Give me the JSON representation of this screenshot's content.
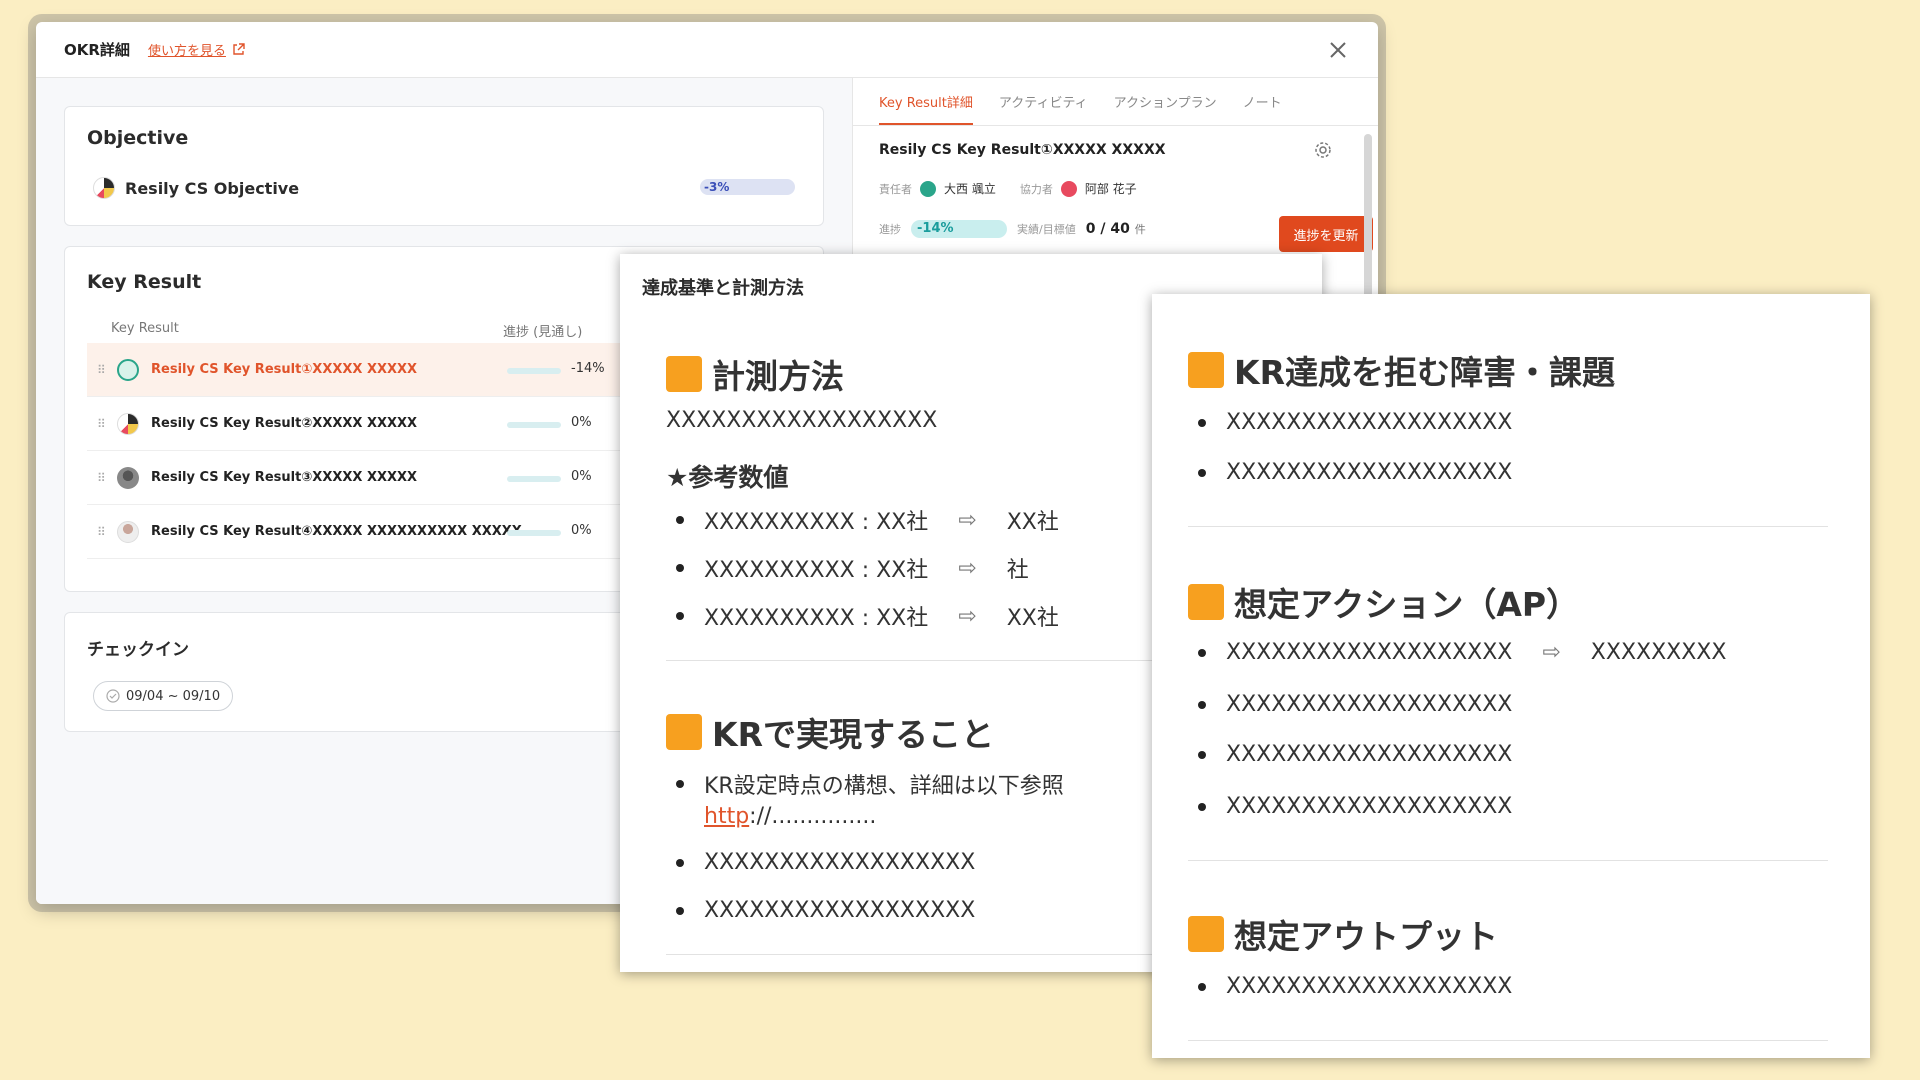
{
  "modal": {
    "title": "OKR詳細",
    "howto_link": "使い方を見る"
  },
  "objective": {
    "heading": "Objective",
    "name": "Resily CS Objective",
    "progress": "-3%"
  },
  "key_result": {
    "heading": "Key Result",
    "col_name": "Key Result",
    "col_progress": "進捗 (見通し)",
    "rows": [
      {
        "label": "Resily CS Key Result①XXXXX XXXXX",
        "progress": "-14%"
      },
      {
        "label": "Resily CS Key Result②XXXXX XXXXX",
        "progress": "0%"
      },
      {
        "label": "Resily CS Key Result③XXXXX XXXXX",
        "progress": "0%"
      },
      {
        "label": "Resily CS Key Result④XXXXX XXXXXXXXXX XXXXX",
        "progress": "0%"
      }
    ]
  },
  "checkin": {
    "heading": "チェックイン",
    "date": "09/04 ~ 09/10"
  },
  "detail": {
    "tabs": [
      "Key Result詳細",
      "アクティビティ",
      "アクションプラン",
      "ノート"
    ],
    "kr_title": "Resily CS Key Result①XXXXX XXXXX",
    "owner_label": "責任者",
    "owner_name": "大西 颯立",
    "collab_label": "協力者",
    "collab_name": "阿部 花子",
    "progress_label": "進捗",
    "progress_value": "-14%",
    "actual_label": "実績/目標値",
    "actual_value": "0 / 40",
    "actual_unit": "件",
    "update_button": "進捗を更新"
  },
  "panel_a": {
    "heading": "達成基準と計測方法",
    "sec1_title": "計測方法",
    "sec1_text": "XXXXXXXXXXXXXXXXXX",
    "ref_title": "★参考数値",
    "ref_items": [
      {
        "left": "XXXXXXXXXX : XX社",
        "arrow": "⇨",
        "right": "XX社"
      },
      {
        "left": "XXXXXXXXXX : XX社",
        "arrow": "⇨",
        "right": "社"
      },
      {
        "left": "XXXXXXXXXX : XX社",
        "arrow": "⇨",
        "right": "XX社"
      }
    ],
    "sec2_title": "KRで実現すること",
    "sec2_item1": "KR設定時点の構想、詳細は以下参照",
    "sec2_link": "http",
    "sec2_link_rest": "://...............",
    "sec2_items": [
      "XXXXXXXXXXXXXXXXXX",
      "XXXXXXXXXXXXXXXXXX"
    ]
  },
  "panel_b": {
    "sec1_title": "KR達成を拒む障害・課題",
    "sec1_items": [
      "XXXXXXXXXXXXXXXXXXX",
      "XXXXXXXXXXXXXXXXXXX"
    ],
    "sec2_title": "想定アクション（AP）",
    "sec2_first_left": "XXXXXXXXXXXXXXXXXXX",
    "sec2_first_arrow": "⇨",
    "sec2_first_right": "XXXXXXXXX",
    "sec2_items": [
      "XXXXXXXXXXXXXXXXXXX",
      "XXXXXXXXXXXXXXXXXXX",
      "XXXXXXXXXXXXXXXXXXX"
    ],
    "sec3_title": "想定アウトプット",
    "sec3_items": [
      "XXXXXXXXXXXXXXXXXXX"
    ]
  },
  "colors": {
    "background": "#fbeec3",
    "accent": "#e0542b",
    "button": "#e0491e",
    "square": "#f7a01f",
    "progress_teal": "#1a9d9d"
  }
}
